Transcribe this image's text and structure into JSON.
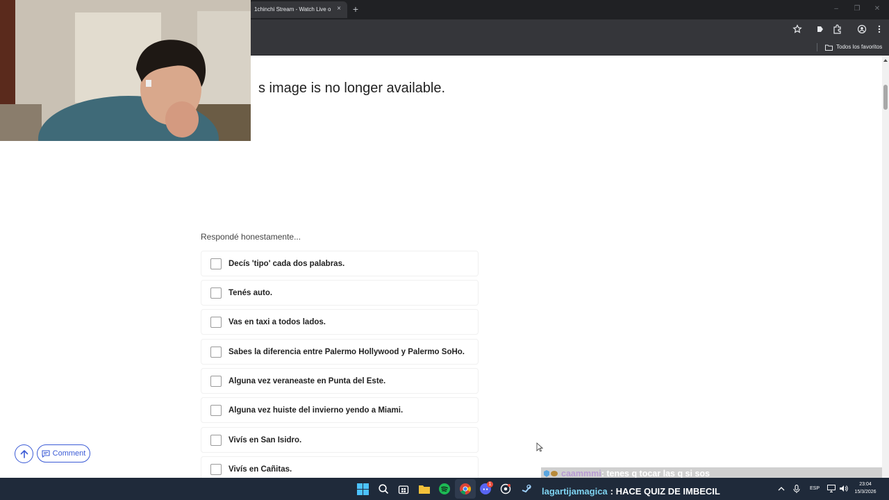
{
  "browser": {
    "tab_title": "1chinchi Stream - Watch Live o",
    "tab_close_glyph": "×",
    "new_tab_glyph": "+",
    "bookmarks_folder": "Todos los favoritos"
  },
  "page": {
    "image_notice": "s image is no longer available.",
    "quiz_prompt": "Respondé honestamente...",
    "quiz_items": [
      "Decís 'tipo' cada dos palabras.",
      "Tenés auto.",
      "Vas en taxi a todos lados.",
      "Sabes la diferencia entre Palermo Hollywood y Palermo SoHo.",
      "Alguna vez veraneaste en Punta del Este.",
      "Alguna vez huiste del invierno yendo a Miami.",
      "Vivís en San Isidro.",
      "Vivís en Cañitas."
    ],
    "comment_button": "Comment"
  },
  "chat": {
    "line1_user": "caammmi",
    "line1_text": ": tenes q tocar las q si sos",
    "line2_user": "lagartijamagica",
    "line2_text": ": HACE QUIZ DE IMBECIL"
  },
  "taskbar": {
    "discord_badge": "1",
    "language": "ESP",
    "time": "23:04",
    "date": "15/3/2026"
  },
  "colors": {
    "accent": "#3b5bd6",
    "chrome_dark": "#202124",
    "chrome_mid": "#35363a",
    "taskbar": "#1f2a3a"
  }
}
